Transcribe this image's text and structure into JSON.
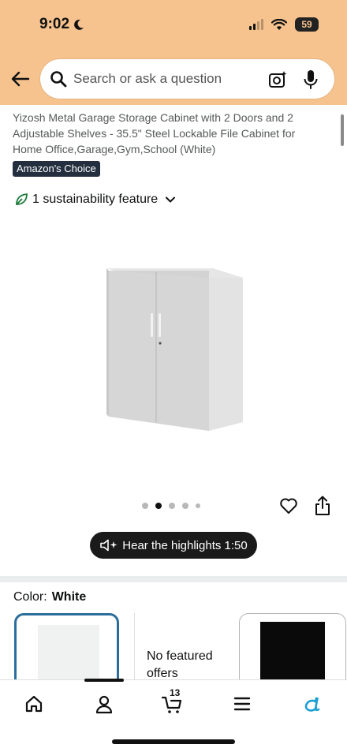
{
  "status_bar": {
    "time": "9:02",
    "battery": "59"
  },
  "search": {
    "placeholder": "Search or ask a question"
  },
  "product": {
    "title": "Yizosh Metal Garage Storage Cabinet with 2 Doors and 2 Adjustable Shelves - 35.5\" Steel Lockable File Cabinet for Home Office,Garage,Gym,School (White)",
    "badge": "Amazon's Choice",
    "sustainability": "1 sustainability feature",
    "image_index": 2,
    "image_count": 5
  },
  "highlights": {
    "label": "Hear the highlights 1:50"
  },
  "color": {
    "label": "Color:",
    "selected": "White",
    "options": [
      {
        "name": "White",
        "swatch": "#f0f1f1"
      },
      {
        "name": "No featured offers"
      },
      {
        "name": "Black",
        "swatch": "#0a0a0a"
      }
    ]
  },
  "bottom_nav": {
    "items": [
      "home-icon",
      "account-icon",
      "cart-icon",
      "menu-icon",
      "rufus-icon"
    ],
    "cart_count": "13"
  },
  "colors": {
    "header_bg": "#f6c38f",
    "selected_border": "#2c6e9b",
    "badge_bg": "#232f3e"
  }
}
